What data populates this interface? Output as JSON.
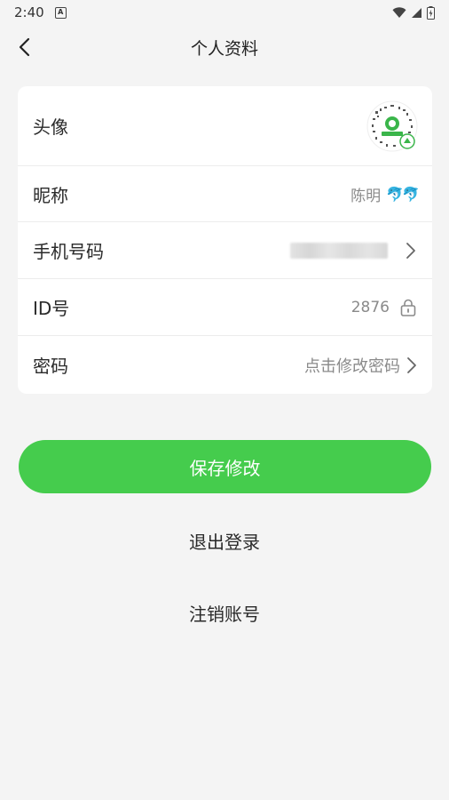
{
  "status_bar": {
    "time": "2:40",
    "app_icon_letter": "A"
  },
  "nav": {
    "title": "个人资料"
  },
  "profile": {
    "avatar_label": "头像",
    "nickname_label": "昵称",
    "nickname_value": "陈明",
    "nickname_emoji": "🐬🐬",
    "phone_label": "手机号码",
    "id_label": "ID号",
    "id_value": "2876",
    "password_label": "密码",
    "password_action": "点击修改密码"
  },
  "actions": {
    "save_label": "保存修改",
    "logout_label": "退出登录",
    "cancel_account_label": "注销账号"
  },
  "colors": {
    "primary": "#45cc4d",
    "background": "#f4f4f4",
    "card": "#ffffff"
  }
}
